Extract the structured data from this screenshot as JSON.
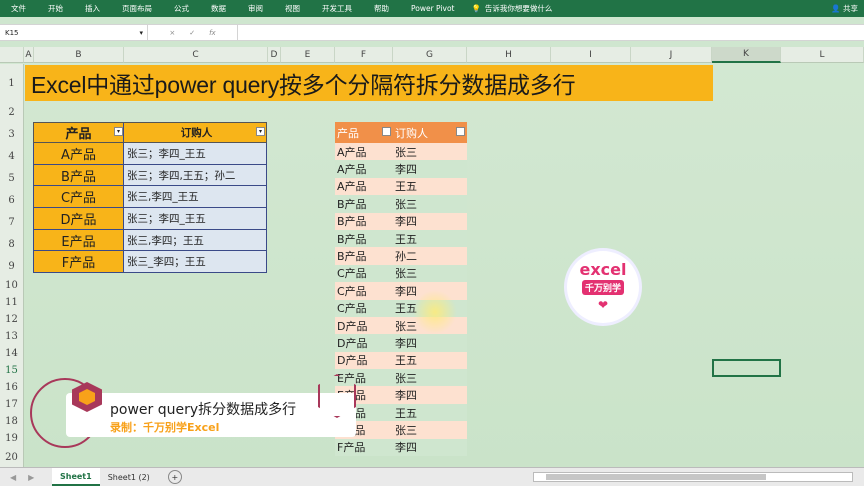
{
  "ribbon": {
    "tabs": [
      "文件",
      "开始",
      "插入",
      "页面布局",
      "公式",
      "数据",
      "审阅",
      "视图",
      "开发工具",
      "帮助",
      "Power Pivot"
    ],
    "tell_me": "告诉我你想要做什么",
    "share": "共享"
  },
  "formula_bar": {
    "name_box": "K15",
    "fx": "fx",
    "cancel": "×",
    "enter": "✓",
    "content": ""
  },
  "columns": [
    "A",
    "B",
    "C",
    "D",
    "E",
    "F",
    "G",
    "H",
    "I",
    "J",
    "K",
    "L"
  ],
  "rows": [
    "1",
    "2",
    "3",
    "4",
    "5",
    "6",
    "7",
    "8",
    "9",
    "10",
    "11",
    "12",
    "13",
    "14",
    "15",
    "16",
    "17",
    "18",
    "19",
    "20"
  ],
  "title": "Excel中通过power query按多个分隔符拆分数据成多行",
  "source_table": {
    "headers": [
      "产品",
      "订购人"
    ],
    "rows": [
      [
        "A产品",
        "张三；李四_王五"
      ],
      [
        "B产品",
        "张三；李四,王五；孙二"
      ],
      [
        "C产品",
        "张三,李四_王五"
      ],
      [
        "D产品",
        "张三；李四_王五"
      ],
      [
        "E产品",
        "张三,李四；王五"
      ],
      [
        "F产品",
        "张三_李四；王五"
      ]
    ]
  },
  "result_table": {
    "headers": [
      "产品",
      "订购人"
    ],
    "rows": [
      [
        "A产品",
        "张三"
      ],
      [
        "A产品",
        "李四"
      ],
      [
        "A产品",
        "王五"
      ],
      [
        "B产品",
        "张三"
      ],
      [
        "B产品",
        "李四"
      ],
      [
        "B产品",
        "王五"
      ],
      [
        "B产品",
        "孙二"
      ],
      [
        "C产品",
        "张三"
      ],
      [
        "C产品",
        "李四"
      ],
      [
        "C产品",
        "王五"
      ],
      [
        "D产品",
        "张三"
      ],
      [
        "D产品",
        "李四"
      ],
      [
        "D产品",
        "王五"
      ],
      [
        "E产品",
        "张三"
      ],
      [
        "E产品",
        "李四"
      ],
      [
        "E产品",
        "王五"
      ],
      [
        "F产品",
        "张三"
      ],
      [
        "F产品",
        "李四"
      ]
    ]
  },
  "logo": {
    "line1": "excel",
    "line2": "千万别学",
    "line3": "❤"
  },
  "banner": {
    "title": "power query拆分数据成多行",
    "subtitle": "录制：千万别学Excel"
  },
  "sheet_tabs": [
    "Sheet1",
    "Sheet1 (2)"
  ],
  "add_sheet": "+"
}
